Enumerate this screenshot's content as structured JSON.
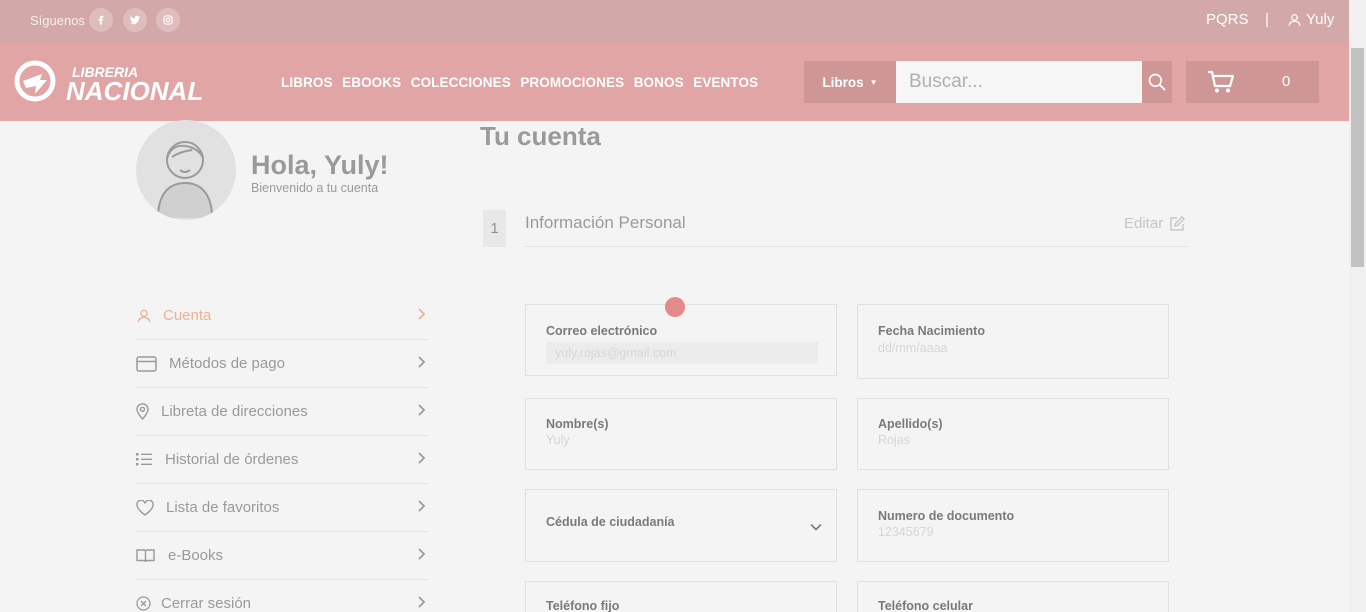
{
  "topbar": {
    "follow_label": "Síguenos",
    "social": [
      "facebook-icon",
      "twitter-icon",
      "instagram-icon"
    ],
    "pqrs": "PQRS",
    "separator": "|",
    "user_name": "Yuly"
  },
  "nav": {
    "logo_line1": "LIBRERIA",
    "logo_line2": "NACIONAL",
    "menu": [
      "LIBROS",
      "EBOOKS",
      "COLECCIONES",
      "PROMOCIONES",
      "BONOS",
      "EVENTOS"
    ],
    "search_category": "Libros",
    "search_placeholder": "Buscar...",
    "cart_count": "0"
  },
  "profile": {
    "greeting": "Hola, Yuly!",
    "welcome": "Bienvenido a tu cuenta"
  },
  "sidebar": {
    "items": [
      {
        "label": "Cuenta",
        "icon": "user-icon",
        "active": true
      },
      {
        "label": "Métodos de pago",
        "icon": "credit-card-icon"
      },
      {
        "label": "Libreta de direcciones",
        "icon": "map-pin-icon"
      },
      {
        "label": "Historial de órdenes",
        "icon": "list-icon"
      },
      {
        "label": "Lista de favoritos",
        "icon": "heart-icon"
      },
      {
        "label": "e-Books",
        "icon": "book-icon"
      },
      {
        "label": "Cerrar sesión",
        "icon": "close-circle-icon"
      }
    ]
  },
  "main": {
    "title": "Tu cuenta",
    "step": "1",
    "section_title": "Información Personal",
    "edit_label": "Editar"
  },
  "form": {
    "email_label": "Correo electrónico",
    "email_value": "yuly.rojas@gmail.com",
    "birth_label": "Fecha Nacimiento",
    "birth_placeholder": "dd/mm/aaaa",
    "name_label": "Nombre(s)",
    "name_value": "Yuly",
    "lastname_label": "Apellido(s)",
    "lastname_value": "Rojas",
    "doc_type_label": "Cédula de ciudadanía",
    "doc_number_label": "Numero de documento",
    "doc_number_value": "12345679",
    "phone_label": "Teléfono fijo",
    "mobile_label": "Teléfono celular"
  },
  "colors": {
    "accent": "#e2a5a5",
    "topbar": "#d3a8a8",
    "active_item": "#f2b08f"
  }
}
